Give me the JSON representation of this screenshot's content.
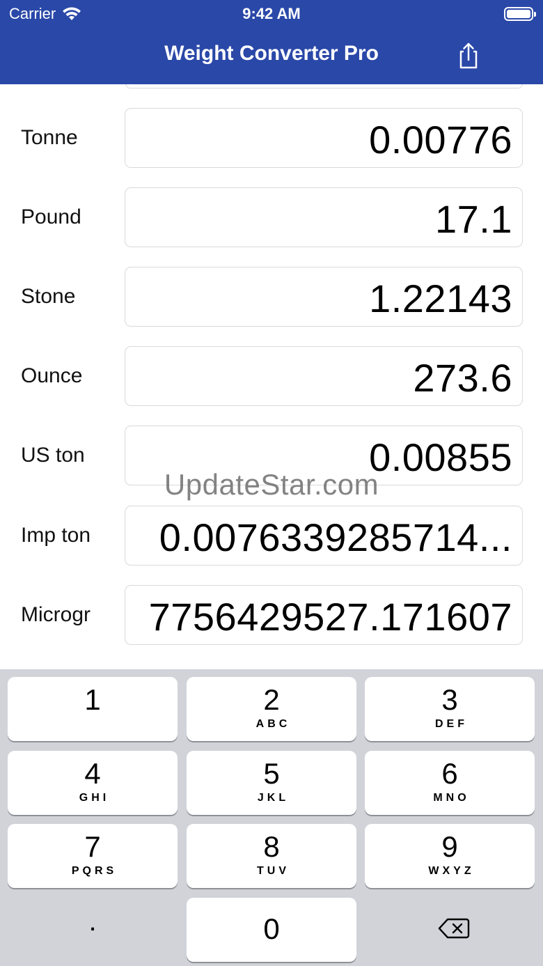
{
  "status_bar": {
    "carrier": "Carrier",
    "time": "9:42 AM"
  },
  "nav": {
    "title": "Weight Converter Pro",
    "share_icon": "share-icon"
  },
  "conversions": [
    {
      "label": "Tonne",
      "value": "0.00776"
    },
    {
      "label": "Pound",
      "value": "17.1"
    },
    {
      "label": "Stone",
      "value": "1.22143"
    },
    {
      "label": "Ounce",
      "value": "273.6"
    },
    {
      "label": "US ton",
      "value": "0.00855"
    },
    {
      "label": "Imp ton",
      "value": "0.0076339285714..."
    },
    {
      "label": "Microgr",
      "value": "7756429527.171607"
    }
  ],
  "watermark": "UpdateStar.com",
  "keypad": {
    "keys": [
      {
        "digit": "1",
        "letters": ""
      },
      {
        "digit": "2",
        "letters": "ABC"
      },
      {
        "digit": "3",
        "letters": "DEF"
      },
      {
        "digit": "4",
        "letters": "GHI"
      },
      {
        "digit": "5",
        "letters": "JKL"
      },
      {
        "digit": "6",
        "letters": "MNO"
      },
      {
        "digit": "7",
        "letters": "PQRS"
      },
      {
        "digit": "8",
        "letters": "TUV"
      },
      {
        "digit": "9",
        "letters": "WXYZ"
      }
    ],
    "decimal": ".",
    "zero": "0",
    "backspace_icon": "backspace-icon"
  },
  "colors": {
    "nav_background": "#2a48a8",
    "keyboard_background": "#d1d3d9"
  }
}
